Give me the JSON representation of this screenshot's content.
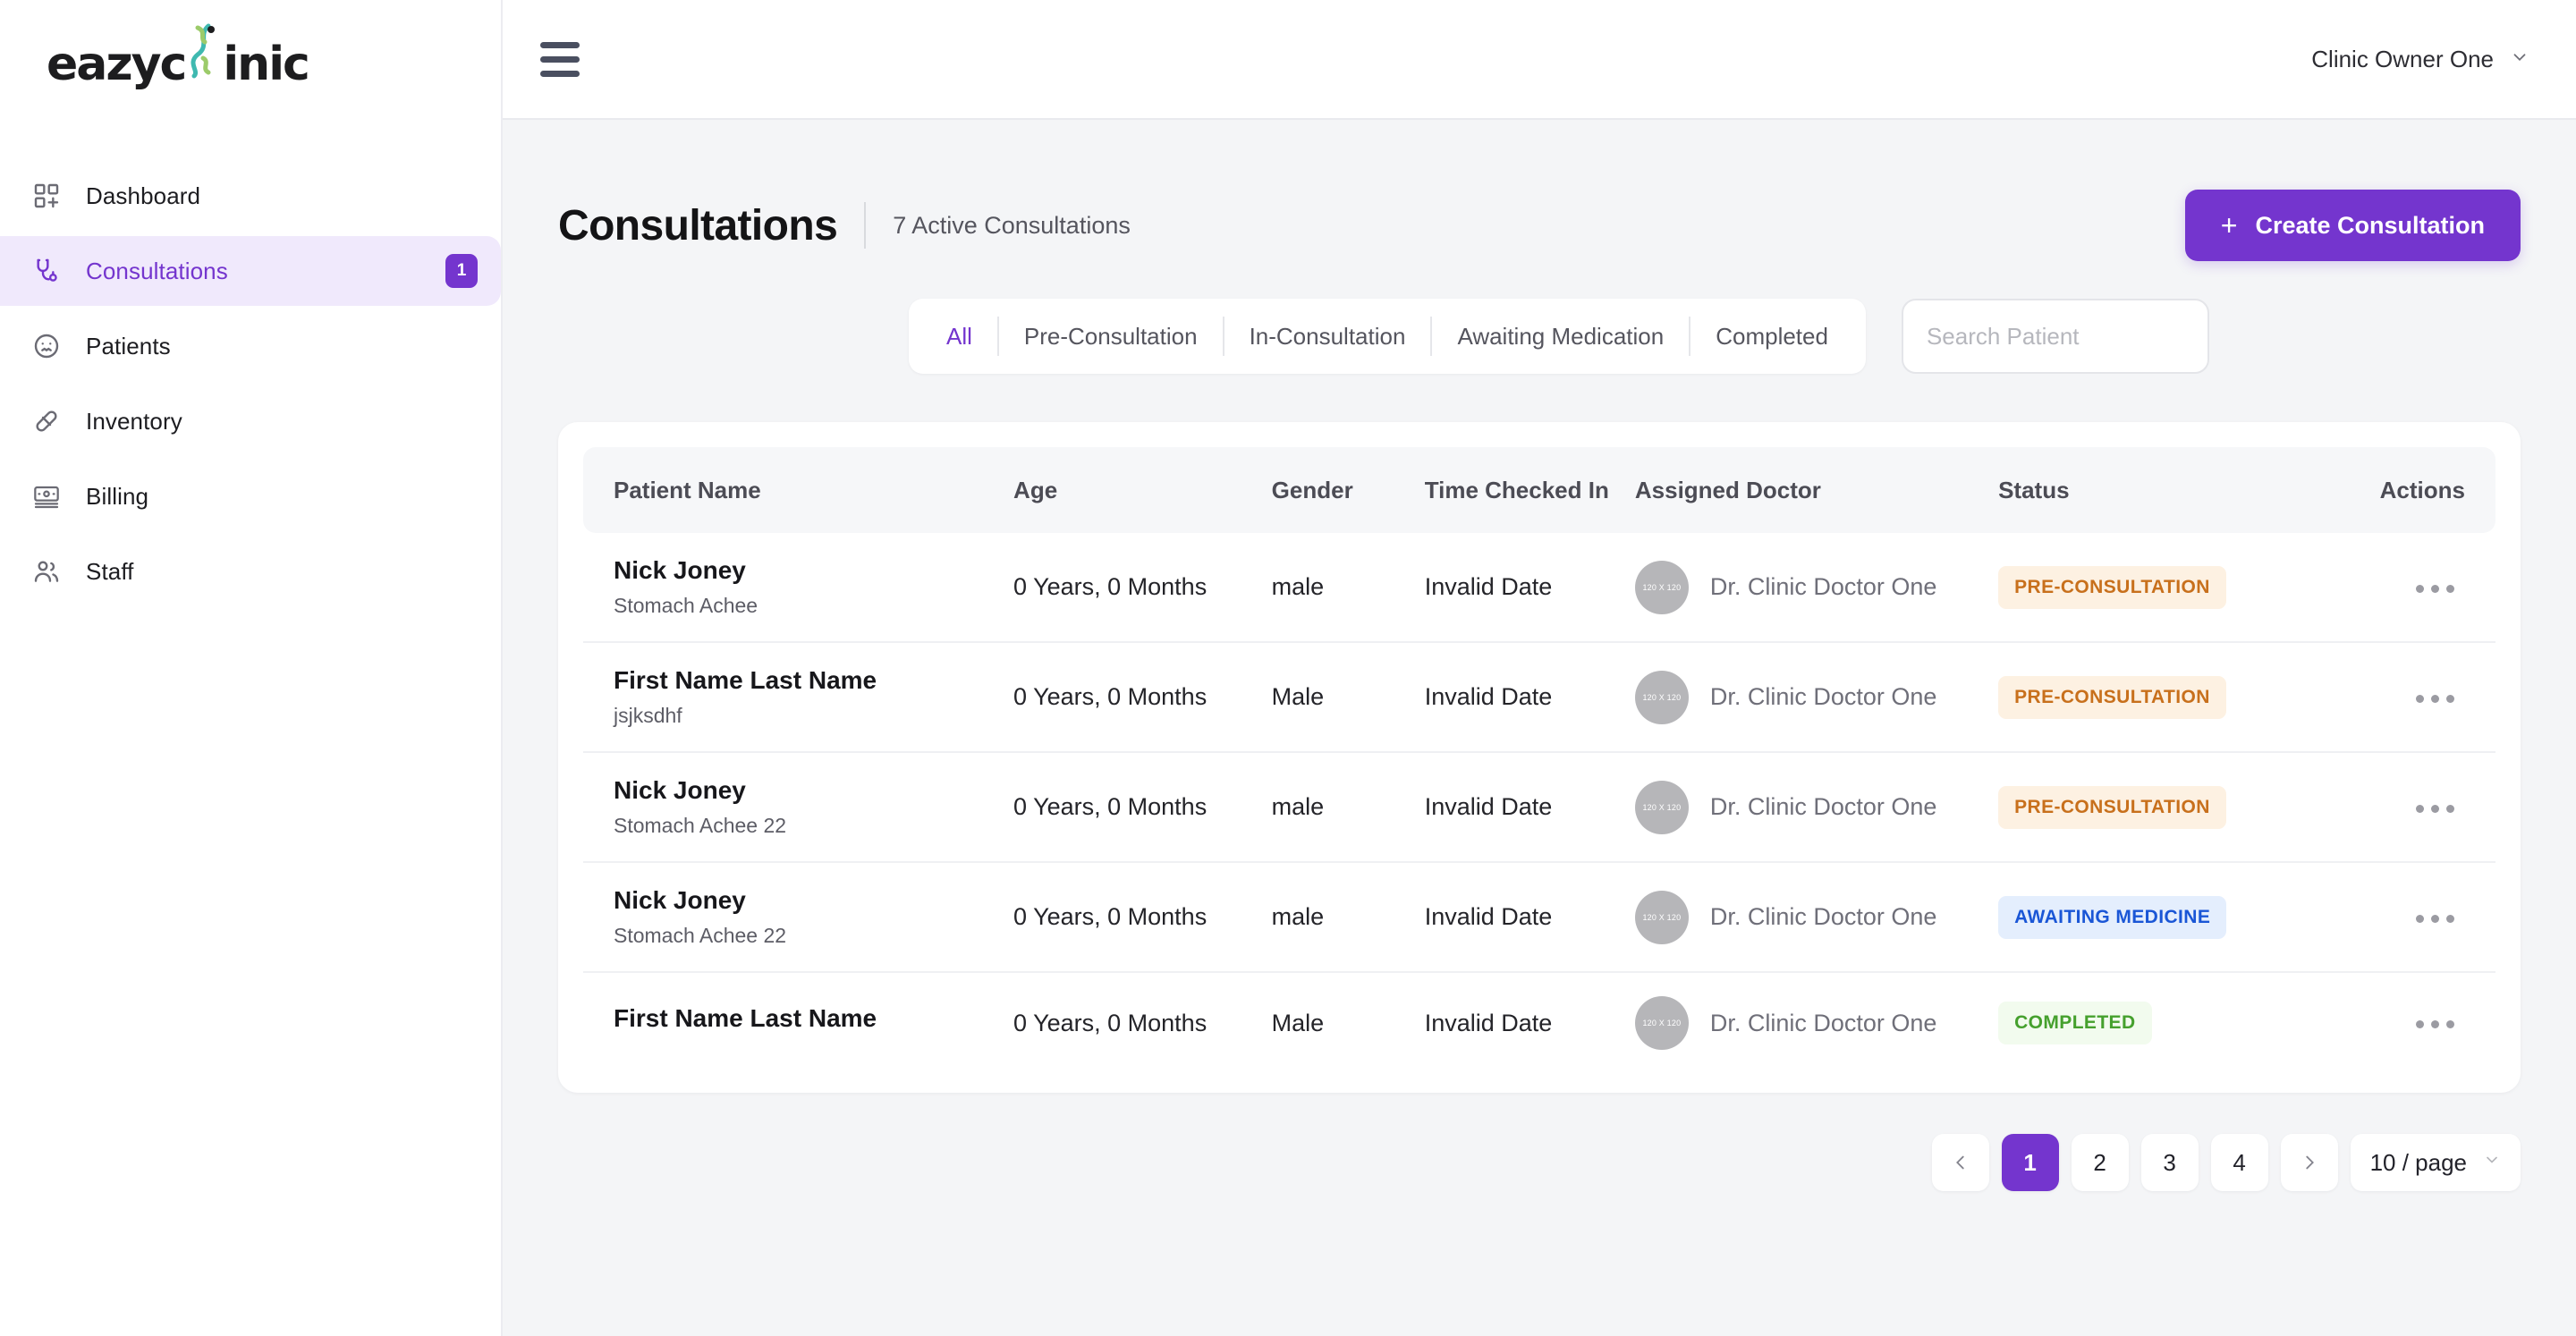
{
  "brand": {
    "name_part1": "eazyc",
    "name_part2": "inic",
    "logo_icon": "dna-helix-icon"
  },
  "topbar": {
    "menu_icon": "hamburger-menu-icon",
    "user_name": "Clinic Owner One",
    "user_chevron_icon": "chevron-down-icon"
  },
  "sidebar": {
    "items": [
      {
        "label": "Dashboard",
        "icon": "dashboard-grid-icon",
        "active": false,
        "badge": ""
      },
      {
        "label": "Consultations",
        "icon": "stethoscope-icon",
        "active": true,
        "badge": "1"
      },
      {
        "label": "Patients",
        "icon": "patient-face-icon",
        "active": false,
        "badge": ""
      },
      {
        "label": "Inventory",
        "icon": "pill-capsule-icon",
        "active": false,
        "badge": ""
      },
      {
        "label": "Billing",
        "icon": "billing-card-icon",
        "active": false,
        "badge": ""
      },
      {
        "label": "Staff",
        "icon": "users-icon",
        "active": false,
        "badge": ""
      }
    ]
  },
  "page": {
    "title": "Consultations",
    "subtitle": "7 Active Consultations",
    "create_button": "Create Consultation",
    "create_icon": "plus-icon"
  },
  "filters": {
    "tabs": [
      {
        "label": "All",
        "active": true
      },
      {
        "label": "Pre-Consultation",
        "active": false
      },
      {
        "label": "In-Consultation",
        "active": false
      },
      {
        "label": "Awaiting Medication",
        "active": false
      },
      {
        "label": "Completed",
        "active": false
      }
    ],
    "search_placeholder": "Search Patient",
    "search_value": ""
  },
  "table": {
    "columns": [
      "Patient Name",
      "Age",
      "Gender",
      "Time Checked In",
      "Assigned Doctor",
      "Status",
      "Actions"
    ],
    "rows": [
      {
        "name": "Nick Joney",
        "note": "Stomach Achee",
        "age": "0 Years, 0 Months",
        "gender": "male",
        "time": "Invalid Date",
        "avatar_text": "120 X 120",
        "doctor": "Dr. Clinic Doctor One",
        "status": "PRE-CONSULTATION",
        "status_type": "pre",
        "actions_icon": "more-options-icon"
      },
      {
        "name": "First Name Last Name",
        "note": "jsjksdhf",
        "age": "0 Years, 0 Months",
        "gender": "Male",
        "time": "Invalid Date",
        "avatar_text": "120 X 120",
        "doctor": "Dr. Clinic Doctor One",
        "status": "PRE-CONSULTATION",
        "status_type": "pre",
        "actions_icon": "more-options-icon"
      },
      {
        "name": "Nick Joney",
        "note": "Stomach Achee 22",
        "age": "0 Years, 0 Months",
        "gender": "male",
        "time": "Invalid Date",
        "avatar_text": "120 X 120",
        "doctor": "Dr. Clinic Doctor One",
        "status": "PRE-CONSULTATION",
        "status_type": "pre",
        "actions_icon": "more-options-icon"
      },
      {
        "name": "Nick Joney",
        "note": "Stomach Achee 22",
        "age": "0 Years, 0 Months",
        "gender": "male",
        "time": "Invalid Date",
        "avatar_text": "120 X 120",
        "doctor": "Dr. Clinic Doctor One",
        "status": "AWAITING MEDICINE",
        "status_type": "awm",
        "actions_icon": "more-options-icon"
      },
      {
        "name": "First Name Last Name",
        "note": "",
        "age": "0 Years, 0 Months",
        "gender": "Male",
        "time": "Invalid Date",
        "avatar_text": "120 X 120",
        "doctor": "Dr. Clinic Doctor One",
        "status": "COMPLETED",
        "status_type": "done",
        "actions_icon": "more-options-icon"
      }
    ]
  },
  "pagination": {
    "prev_icon": "chevron-left-icon",
    "next_icon": "chevron-right-icon",
    "pages": [
      "1",
      "2",
      "3",
      "4"
    ],
    "current_page": "1",
    "page_size": "10 / page",
    "page_size_chevron": "chevron-down-icon"
  },
  "colors": {
    "accent": "#7435ce",
    "accent_soft": "#f0e9fc",
    "status_pre_bg": "#fdf1e2",
    "status_pre_fg": "#c8701c",
    "status_awm_bg": "#e4eefd",
    "status_awm_fg": "#1a56d6",
    "status_done_bg": "#f2fbee",
    "status_done_fg": "#45a02d",
    "page_bg": "#f4f5f7"
  }
}
